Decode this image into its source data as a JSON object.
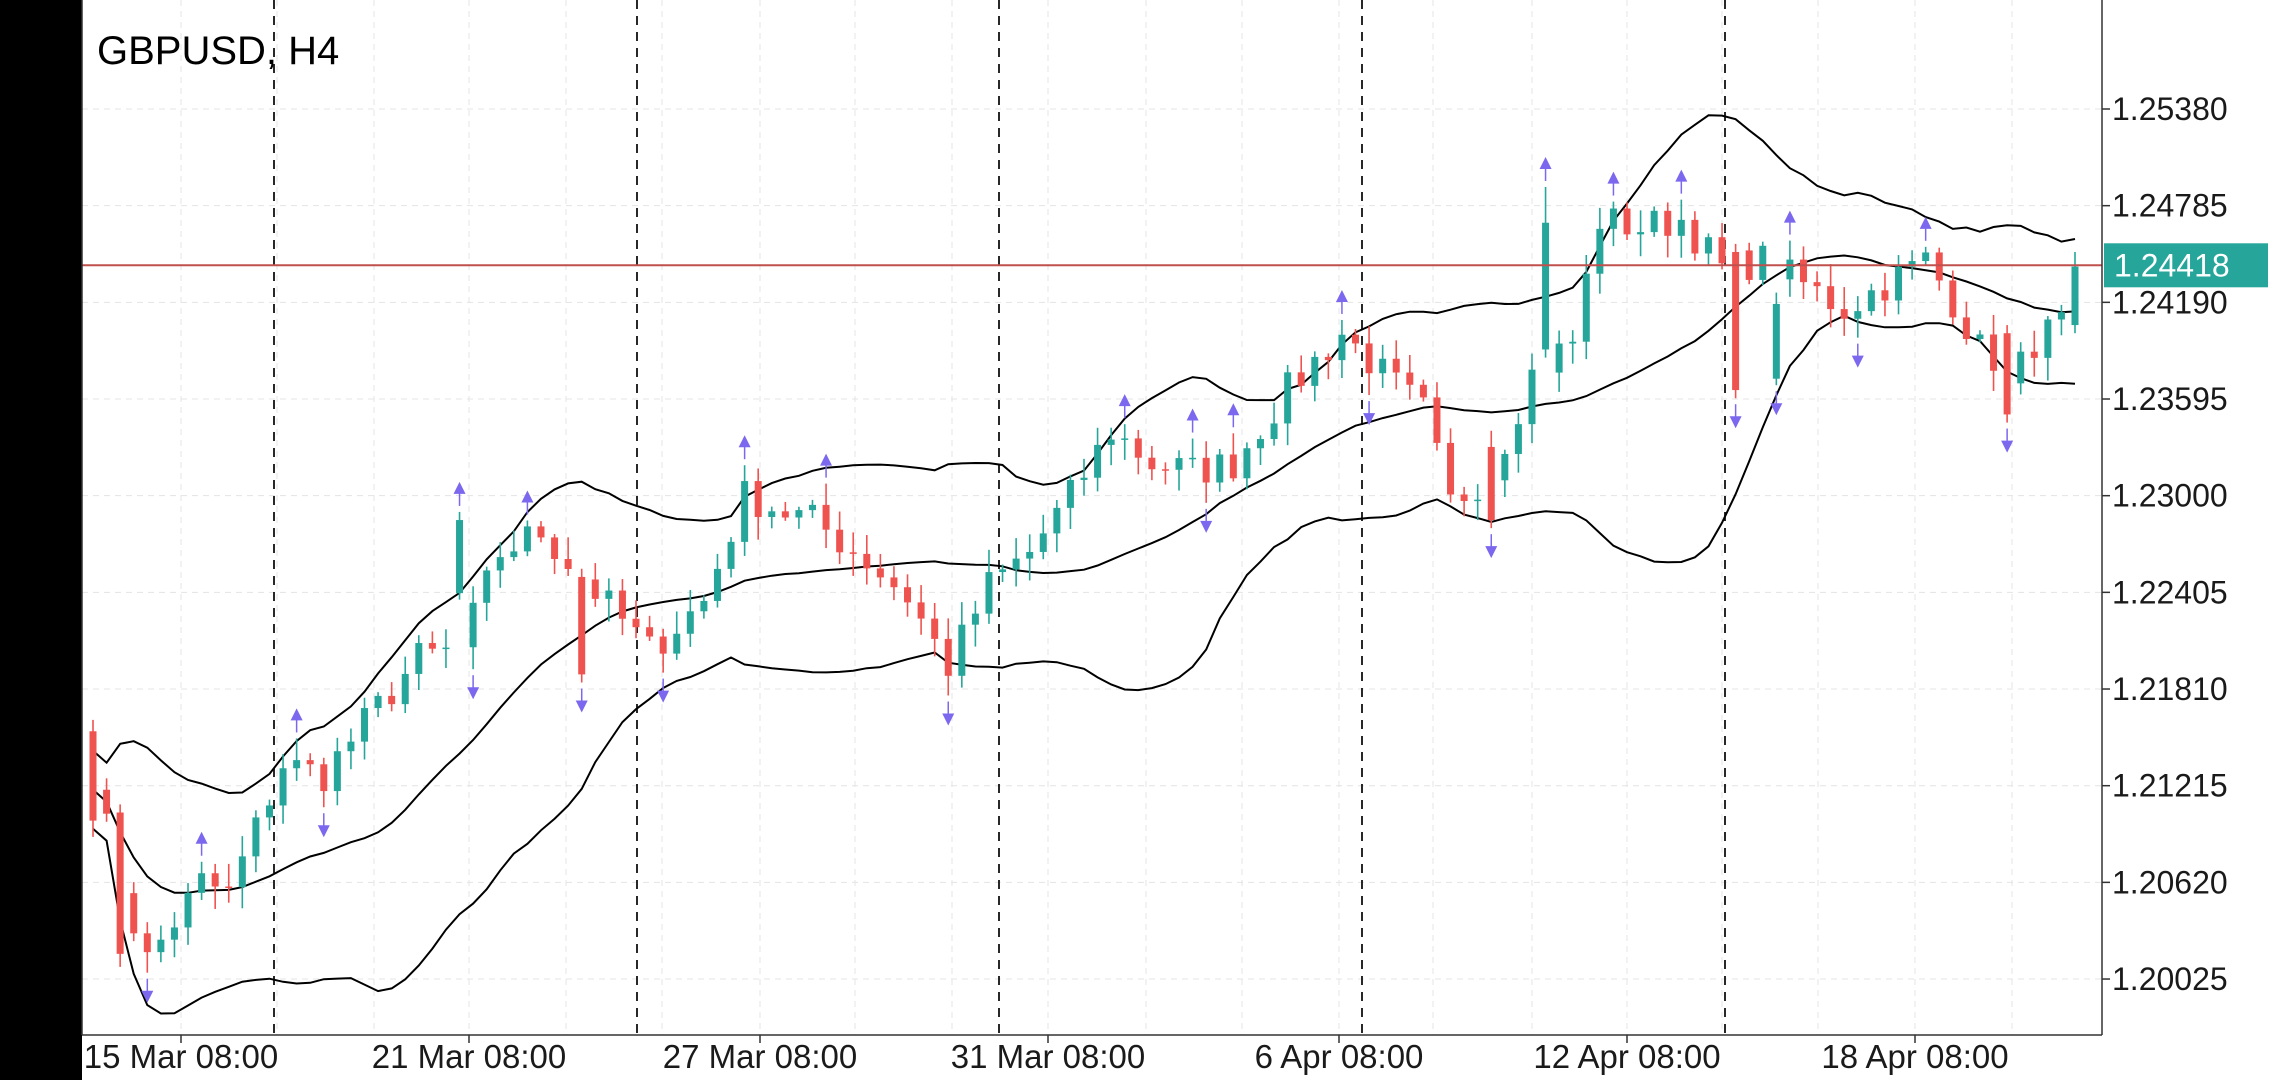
{
  "chart_data": {
    "type": "candlestick",
    "title": "GBPUSD, H4",
    "y_ticks": [
      "1.25380",
      "1.24785",
      "1.24190",
      "1.23595",
      "1.23000",
      "1.22405",
      "1.21810",
      "1.21215",
      "1.20620",
      "1.20025"
    ],
    "x_ticks": [
      "15 Mar 08:00",
      "21 Mar 08:00",
      "27 Mar 08:00",
      "31 Mar 08:00",
      "6 Apr 08:00",
      "12 Apr 08:00",
      "18 Apr 08:00"
    ],
    "current_price": "1.24418",
    "colors": {
      "bull": "#26a69a",
      "bear": "#ef5350",
      "fractal": "#7b68ee",
      "bands": "#000000",
      "price_line": "#c0504d",
      "price_label_bg": "#26a69a"
    },
    "indicators": [
      "Bollinger Bands",
      "Fractals"
    ],
    "grid": true,
    "period_separators": true
  }
}
